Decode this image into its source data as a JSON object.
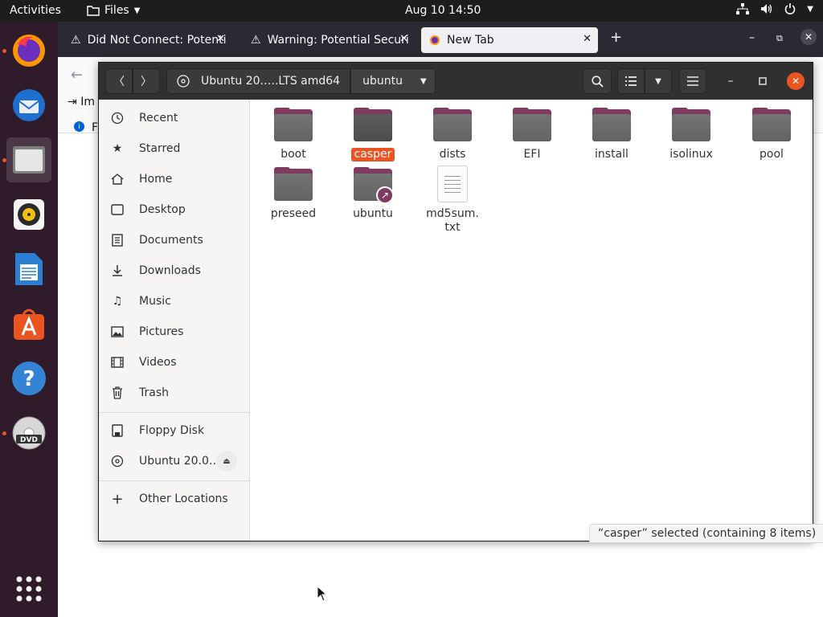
{
  "topbar": {
    "activities": "Activities",
    "app_name": "Files",
    "clock": "Aug 10  14:50"
  },
  "dock": {
    "items": [
      {
        "name": "Firefox",
        "icon": "firefox-icon",
        "running": true
      },
      {
        "name": "Thunderbird",
        "icon": "thunderbird-icon",
        "running": false
      },
      {
        "name": "Files",
        "icon": "files-icon",
        "running": true,
        "active": true
      },
      {
        "name": "Rhythmbox",
        "icon": "rhythmbox-icon",
        "running": false
      },
      {
        "name": "LibreOffice Writer",
        "icon": "writer-icon",
        "running": false
      },
      {
        "name": "Ubuntu Software",
        "icon": "software-icon",
        "running": false
      },
      {
        "name": "Help",
        "icon": "help-icon",
        "running": false
      },
      {
        "name": "DVD",
        "icon": "dvd-icon",
        "running": true
      }
    ]
  },
  "firefox": {
    "tabs": [
      {
        "label": "Did Not Connect: Potenti",
        "selected": false
      },
      {
        "label": "Warning: Potential Securi",
        "selected": false
      },
      {
        "label": "New Tab",
        "selected": true
      }
    ],
    "partial_text_1": "Im",
    "partial_text_2": "F"
  },
  "nautilus": {
    "path": {
      "drive": "Ubuntu 20.….LTS amd64",
      "folder": "ubuntu"
    },
    "sidebar": {
      "places": [
        {
          "label": "Recent",
          "icon": "clock-icon"
        },
        {
          "label": "Starred",
          "icon": "star-icon"
        },
        {
          "label": "Home",
          "icon": "home-icon"
        },
        {
          "label": "Desktop",
          "icon": "desktop-icon"
        },
        {
          "label": "Documents",
          "icon": "documents-icon"
        },
        {
          "label": "Downloads",
          "icon": "downloads-icon"
        },
        {
          "label": "Music",
          "icon": "music-icon"
        },
        {
          "label": "Pictures",
          "icon": "pictures-icon"
        },
        {
          "label": "Videos",
          "icon": "videos-icon"
        },
        {
          "label": "Trash",
          "icon": "trash-icon"
        }
      ],
      "devices": [
        {
          "label": "Floppy Disk",
          "icon": "floppy-icon"
        },
        {
          "label": "Ubuntu 20.0…",
          "icon": "optical-disc-icon"
        }
      ],
      "other": {
        "label": "Other Locations",
        "icon": "plus-icon"
      }
    },
    "files": [
      {
        "name": "boot",
        "type": "folder"
      },
      {
        "name": "casper",
        "type": "folder",
        "selected": true
      },
      {
        "name": "dists",
        "type": "folder"
      },
      {
        "name": "EFI",
        "type": "folder"
      },
      {
        "name": "install",
        "type": "folder"
      },
      {
        "name": "isolinux",
        "type": "folder"
      },
      {
        "name": "pool",
        "type": "folder"
      },
      {
        "name": "preseed",
        "type": "folder"
      },
      {
        "name": "ubuntu",
        "type": "folder-link"
      },
      {
        "name_line1": "md5sum.",
        "name_line2": "txt",
        "type": "text"
      }
    ],
    "status": "“casper” selected  (containing 8 items)",
    "accent_color": "#e95420"
  }
}
